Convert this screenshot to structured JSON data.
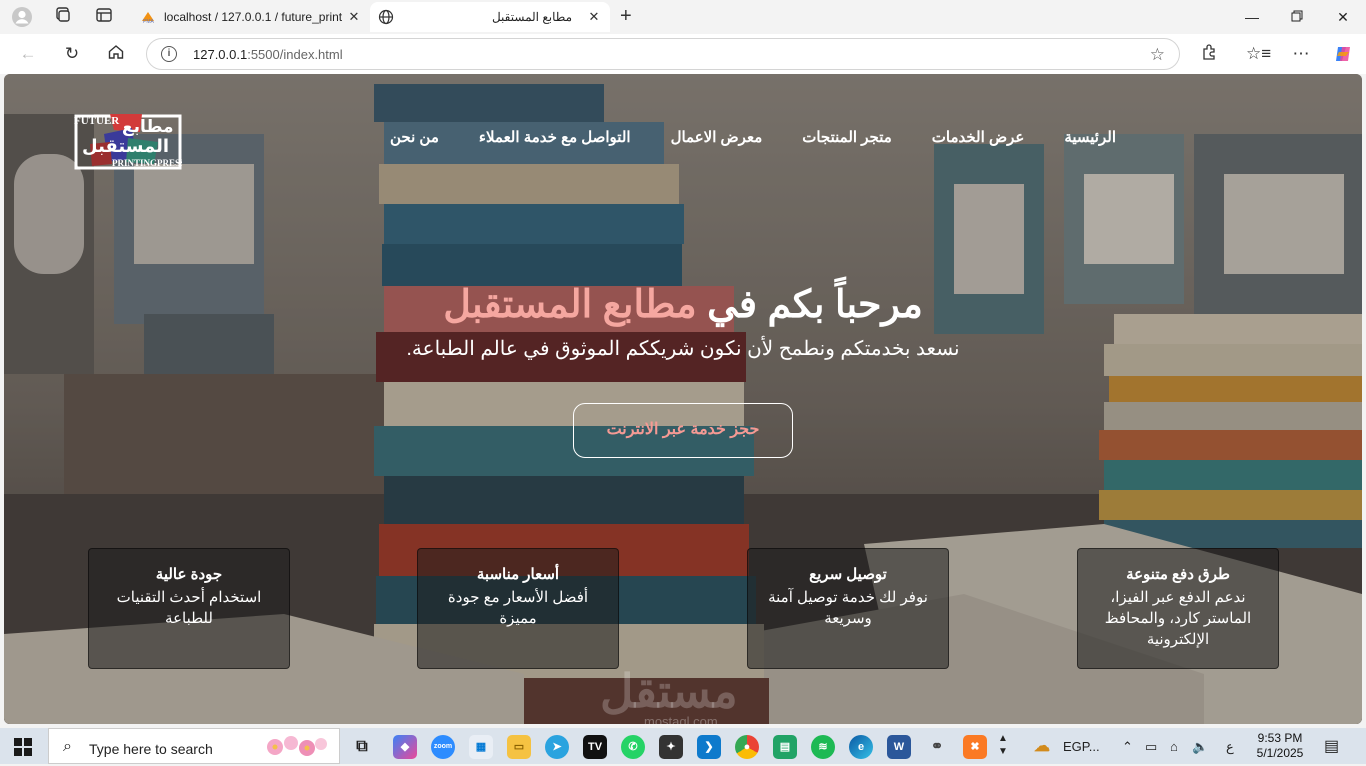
{
  "browser": {
    "tabs": [
      {
        "title": "localhost / 127.0.0.1 / future_print",
        "favicon": "phpmyadmin-icon"
      },
      {
        "title": "مطابع المستقبل",
        "favicon": "globe-icon"
      }
    ],
    "url_host": "127.0.0.1",
    "url_rest": ":5500/index.html"
  },
  "site": {
    "logo_lines": [
      "FUTUER",
      "مطابع",
      "المستقبل",
      "PRINTINGPRESS"
    ],
    "menu": [
      "الرئيسية",
      "عرض الخدمات",
      "متجر المنتجات",
      "معرض الاعمال",
      "التواصل مع خدمة العملاء",
      "من نحن"
    ],
    "hero": {
      "title_prefix": "مرحباً بكم في ",
      "title_accent": "مطابع المستقبل",
      "subtitle": "نسعد بخدمتكم ونطمح لأن نكون شريككم الموثوق في عالم الطباعة.",
      "cta": "حجز خدمة عبر الانترنت"
    },
    "features": [
      {
        "title": "طرق دفع متنوعة",
        "text": "ندعم الدفع عبر الفيزا، الماستر كارد، والمحافظ الإلكترونية"
      },
      {
        "title": "توصيل سريع",
        "text": "نوفر لك خدمة توصيل آمنة وسريعة"
      },
      {
        "title": "أسعار مناسبة",
        "text": "أفضل الأسعار مع جودة مميزة"
      },
      {
        "title": "جودة عالية",
        "text": "استخدام أحدث التقنيات للطباعة"
      }
    ],
    "watermark": "مستقل",
    "watermark_url": "mostaql.com"
  },
  "taskbar": {
    "search_placeholder": "Type here to search",
    "weather": "EGP...",
    "lang": "ع",
    "time": "9:53 PM",
    "date": "5/1/2025"
  }
}
